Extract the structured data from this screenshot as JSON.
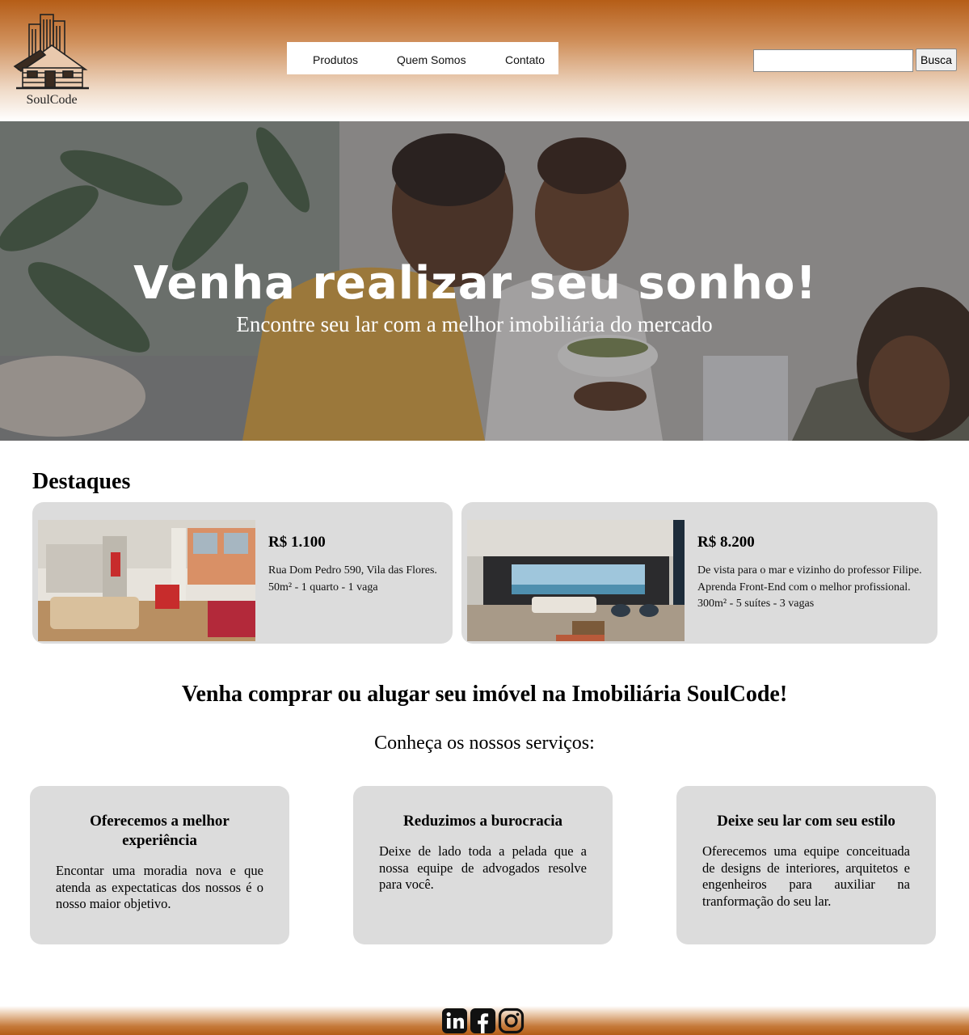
{
  "header": {
    "logo_text": "SoulCode",
    "nav": [
      {
        "label": "Produtos"
      },
      {
        "label": "Quem Somos"
      },
      {
        "label": "Contato"
      }
    ],
    "search": {
      "placeholder": "",
      "value": "",
      "button_label": "Busca"
    }
  },
  "hero": {
    "title": "Venha realizar seu sonho!",
    "subtitle": "Encontre seu lar com a melhor imobiliária do mercado"
  },
  "featured": {
    "title": "Destaques",
    "cards": [
      {
        "price": "R$ 1.100",
        "lines": [
          "Rua Dom Pedro 590, Vila das Flores.",
          "50m² - 1 quarto - 1 vaga"
        ]
      },
      {
        "price": "R$ 8.200",
        "lines": [
          "De vista para o mar e vizinho do professor Filipe.",
          "Aprenda Front-End com o melhor profissional.",
          "300m² - 5 suítes - 3 vagas"
        ]
      }
    ]
  },
  "tagline": "Venha comprar ou alugar seu imóvel na Imobiliária SoulCode!",
  "services": {
    "intro": "Conheça os nossos serviços:",
    "items": [
      {
        "title": "Oferecemos a melhor experiência",
        "text": "Encontar uma moradia nova e que atenda as expectaticas dos nossos é o nosso maior objetivo."
      },
      {
        "title": "Reduzimos a burocracia",
        "text": "Deixe de lado toda a pelada que a nossa equipe de advogados resolve para você."
      },
      {
        "title": "Deixe seu lar com seu estilo",
        "text": "Oferecemos uma equipe conceituada de designs de interiores, arquitetos e engenheiros para auxiliar na tranformação do seu lar."
      }
    ]
  },
  "footer": {
    "icons": [
      "linkedin-icon",
      "facebook-icon",
      "instagram-icon"
    ]
  },
  "colors": {
    "brand_brown": "#b55d17",
    "card_gray": "#dcdcdc"
  }
}
